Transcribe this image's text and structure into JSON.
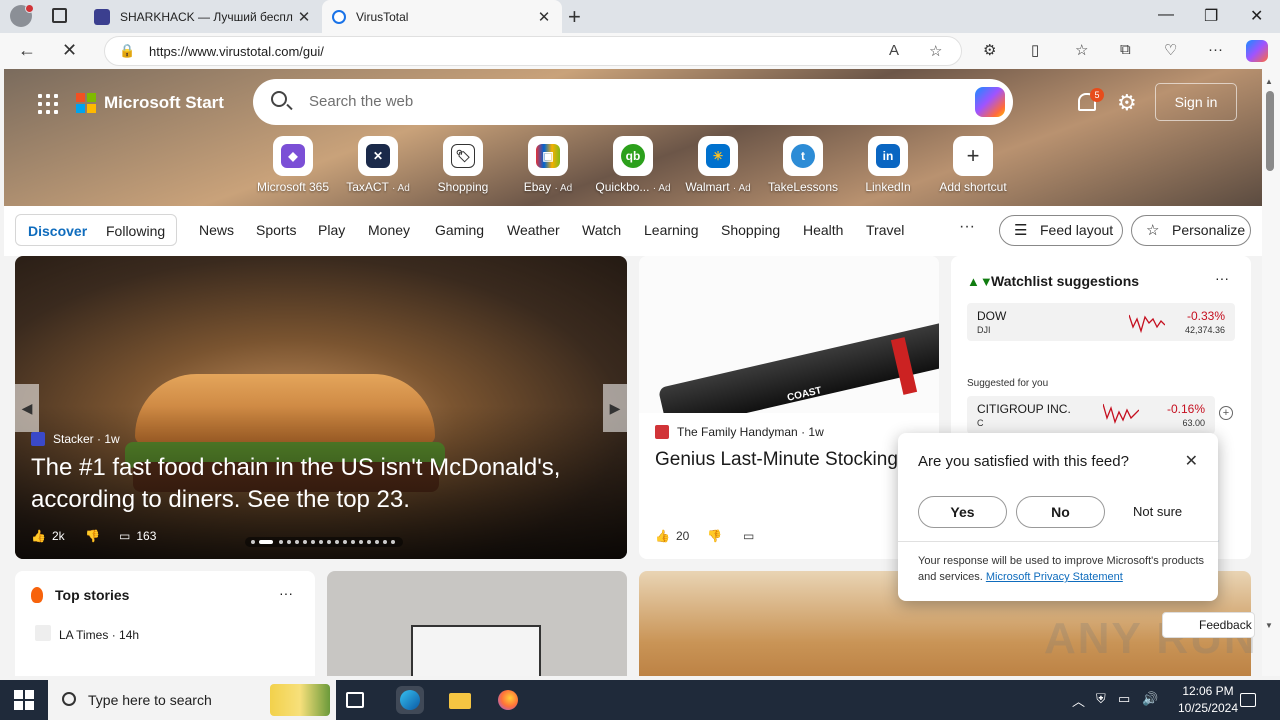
{
  "browser": {
    "tabs": [
      {
        "title": "SHARKHACK — Лучший беспл",
        "favicon_color": "#3b3f8f"
      },
      {
        "title": "VirusTotal",
        "favicon_color": "#1a73e8"
      }
    ],
    "url": "https://www.virustotal.com/gui/",
    "new_tab": "+",
    "win_minimize": "—",
    "win_restore": "❐",
    "win_close": "✕"
  },
  "msn": {
    "brand": "Microsoft Start",
    "search_placeholder": "Search the web",
    "notifications_count": "5",
    "sign_in": "Sign in",
    "shortcuts": [
      {
        "label": "Microsoft 365",
        "ad": "",
        "color": "#7b4fd6",
        "glyph": "◆"
      },
      {
        "label": "TaxACT",
        "ad": "· Ad",
        "color": "#1b2a4a",
        "glyph": "✕"
      },
      {
        "label": "Shopping",
        "ad": "",
        "color": "#ffffff",
        "glyph": "🏷"
      },
      {
        "label": "Ebay",
        "ad": "· Ad",
        "color": "#e53238",
        "glyph": "▣"
      },
      {
        "label": "Quickbo...",
        "ad": "· Ad",
        "color": "#2ca01c",
        "glyph": "qb"
      },
      {
        "label": "Walmart",
        "ad": "· Ad",
        "color": "#0071ce",
        "glyph": "✳"
      },
      {
        "label": "TakeLessons",
        "ad": "",
        "color": "#2d8cd6",
        "glyph": "t"
      },
      {
        "label": "LinkedIn",
        "ad": "",
        "color": "#0a66c2",
        "glyph": "in"
      },
      {
        "label": "Add shortcut",
        "ad": "",
        "color": "#ffffff",
        "glyph": "+"
      }
    ],
    "feed_toggle": {
      "discover": "Discover",
      "following": "Following"
    },
    "categories": [
      "News",
      "Sports",
      "Play",
      "Money",
      "Gaming",
      "Weather",
      "Watch",
      "Learning",
      "Shopping",
      "Health",
      "Travel"
    ],
    "more": "···",
    "feed_layout": "Feed layout",
    "personalize": "Personalize"
  },
  "hero": {
    "source": "Stacker",
    "age": "· 1w",
    "title": "The #1 fast food chain in the US isn't McDonald's, according to diners. See the top 23.",
    "likes": "2k",
    "comments": "163"
  },
  "flash_card": {
    "source": "The Family Handyman",
    "age": "· 1w",
    "title": "Genius Last-Minute Stocking Stuffers for DIYers",
    "product_text": "COAST",
    "likes": "20"
  },
  "watchlist": {
    "title": "Watchlist suggestions",
    "more": "···",
    "stocks": [
      {
        "name": "DOW",
        "ticker": "DJI",
        "change": "-0.33%",
        "value": "42,374.36"
      },
      {
        "name": "CITIGROUP INC.",
        "ticker": "C",
        "change": "-0.16%",
        "value": "63.00"
      }
    ],
    "suggested_label": "Suggested for you",
    "link_fragment": "ns"
  },
  "top_stories": {
    "title": "Top stories",
    "more": "···",
    "source": "LA Times · 14h"
  },
  "survey": {
    "question": "Are you satisfied with this feed?",
    "yes": "Yes",
    "no": "No",
    "not_sure": "Not sure",
    "note": "Your response will be used to improve Microsoft's products and services.",
    "privacy_link": "Microsoft Privacy Statement"
  },
  "feedback": "Feedback",
  "watermark": "ANY RUN",
  "taskbar": {
    "search_placeholder": "Type here to search",
    "time": "12:06 PM",
    "date": "10/25/2024"
  }
}
